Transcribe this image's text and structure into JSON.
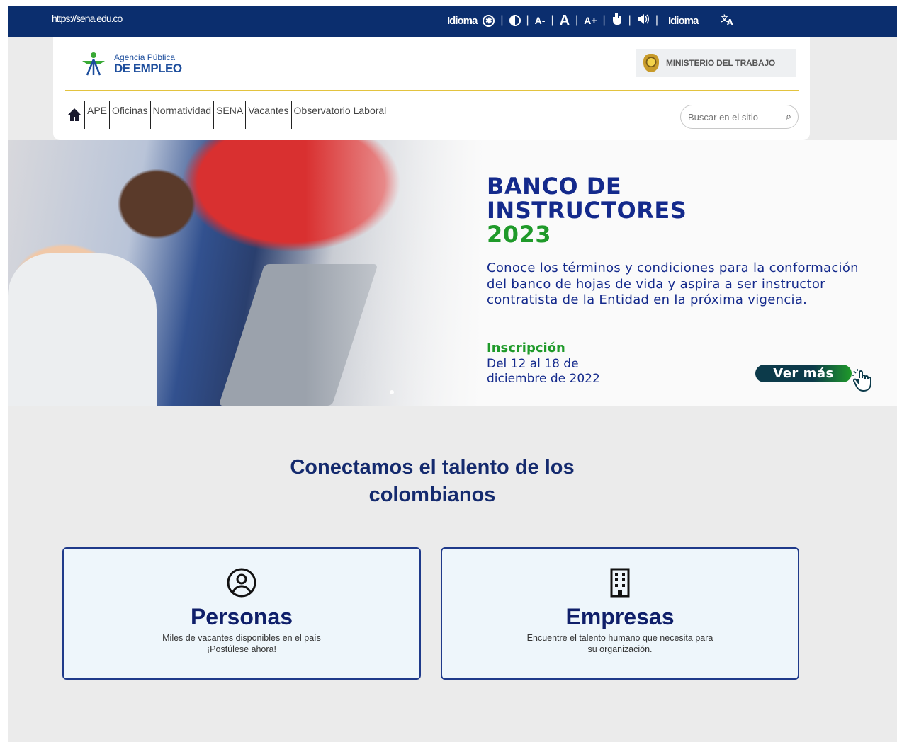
{
  "topbar": {
    "url": "https://sena.edu.co",
    "idioma_left": "Idioma",
    "font_decrease": "A-",
    "font_normal": "A",
    "font_increase": "A+",
    "idioma_right": "Idioma",
    "icons": [
      "accessibility-icon",
      "contrast-icon",
      "font-decrease-icon",
      "font-normal-icon",
      "font-increase-icon",
      "sign-language-icon",
      "audio-icon",
      "translate-icon"
    ]
  },
  "header": {
    "logo_line1": "Agencia Pública",
    "logo_line2": "DE EMPLEO",
    "ministry": "MINISTERIO DEL TRABAJO",
    "nav": [
      "APE",
      "Oficinas",
      "Normatividad",
      "SENA",
      "Vacantes",
      "Observatorio Laboral"
    ],
    "search_placeholder": "Buscar en el sitio"
  },
  "banner": {
    "title_line1": "BANCO DE",
    "title_line2": "INSTRUCTORES",
    "title_year": "2023",
    "description": "Conoce los términos y condiciones para la conformación del banco de hojas de vida y aspira a ser instructor contratista de la Entidad en la próxima vigencia.",
    "inscription_label": "Inscripción",
    "date_line1": "Del 12 al 18 de",
    "date_line2": "diciembre de 2022",
    "cta": "Ver más"
  },
  "main": {
    "headline_line1": "Conectamos el talento de los",
    "headline_line2": "colombianos",
    "cards": [
      {
        "title": "Personas",
        "line1": "Miles de vacantes disponibles en el país",
        "line2": "¡Postúlese ahora!",
        "icon": "user-icon"
      },
      {
        "title": "Empresas",
        "line1": "Encuentre el talento humano que necesita para",
        "line2": "su organización.",
        "icon": "building-icon"
      }
    ]
  },
  "colors": {
    "topbar": "#0b2e6e",
    "accent_gold": "#e3c33f",
    "title_blue": "#142a8c",
    "green": "#1f9a2a"
  }
}
